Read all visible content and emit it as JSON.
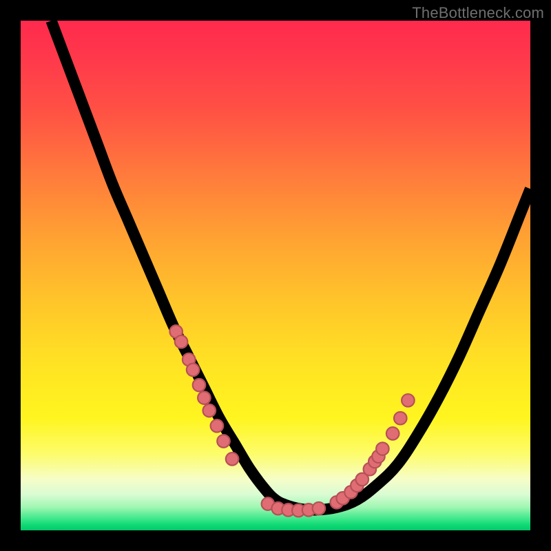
{
  "watermark": "TheBottleneck.com",
  "colors": {
    "gradient_top": "#ff2a4d",
    "gradient_mid": "#ffe423",
    "gradient_bottom": "#04c96a",
    "curve": "#000000",
    "dot_fill": "#e06d74",
    "dot_stroke": "#b65057",
    "frame": "#000000"
  },
  "chart_data": {
    "type": "line",
    "title": "",
    "xlabel": "",
    "ylabel": "",
    "xlim": [
      0,
      100
    ],
    "ylim": [
      0,
      100
    ],
    "axes_visible": false,
    "series": [
      {
        "name": "curve",
        "style": "line",
        "color": "#000000",
        "x": [
          6,
          9,
          12,
          15,
          18,
          21,
          24,
          27,
          30,
          33,
          36,
          39,
          42,
          45,
          48,
          50,
          52,
          55,
          58,
          62,
          66,
          70,
          74,
          78,
          82,
          86,
          90,
          94,
          98,
          100
        ],
        "y": [
          100,
          92,
          84,
          76,
          68,
          61,
          54,
          47,
          40,
          34,
          28,
          22,
          17,
          12,
          8,
          6,
          5,
          4.2,
          4,
          4.5,
          6,
          9,
          13,
          19,
          26,
          34,
          43,
          52,
          62,
          67
        ]
      },
      {
        "name": "left-cluster-markers",
        "style": "scatter",
        "color": "#e06d74",
        "x": [
          30.5,
          31.5,
          33.0,
          33.8,
          35.0,
          36.0,
          37.0,
          38.5,
          39.8,
          41.5
        ],
        "y": [
          39.0,
          37.0,
          33.5,
          31.5,
          28.5,
          26.0,
          23.5,
          20.5,
          17.5,
          14.0
        ]
      },
      {
        "name": "trough-markers",
        "style": "scatter",
        "color": "#e06d74",
        "x": [
          48.5,
          50.5,
          52.5,
          54.5,
          56.5,
          58.5
        ],
        "y": [
          5.2,
          4.3,
          4.0,
          3.9,
          4.0,
          4.3
        ]
      },
      {
        "name": "right-cluster-markers",
        "style": "scatter",
        "color": "#e06d74",
        "x": [
          62.0,
          63.2,
          64.8,
          66.0,
          67.0,
          68.5,
          69.5,
          70.2,
          71.0,
          73.0,
          74.5,
          76.0
        ],
        "y": [
          5.5,
          6.3,
          7.5,
          8.8,
          10.0,
          12.0,
          13.5,
          14.5,
          16.0,
          19.0,
          22.0,
          25.5
        ]
      }
    ]
  }
}
